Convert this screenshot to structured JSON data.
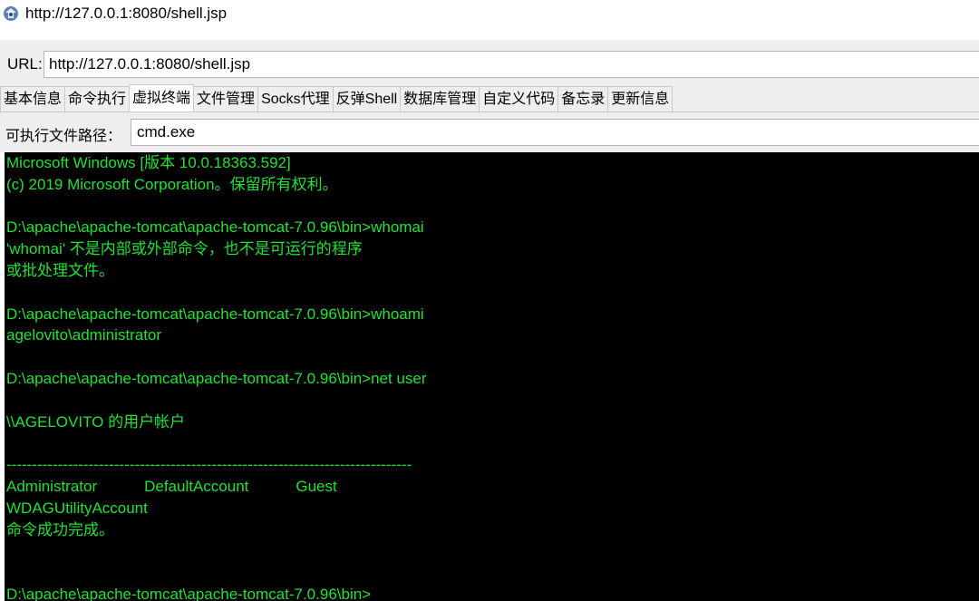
{
  "window": {
    "title": "http://127.0.0.1:8080/shell.jsp"
  },
  "url_bar": {
    "label": "URL:",
    "value": "http://127.0.0.1:8080/shell.jsp"
  },
  "tabs": [
    {
      "label": "基本信息",
      "active": false
    },
    {
      "label": "命令执行",
      "active": false
    },
    {
      "label": "虚拟终端",
      "active": true
    },
    {
      "label": "文件管理",
      "active": false
    },
    {
      "label": "Socks代理",
      "active": false
    },
    {
      "label": "反弹Shell",
      "active": false
    },
    {
      "label": "数据库管理",
      "active": false
    },
    {
      "label": "自定义代码",
      "active": false
    },
    {
      "label": "备忘录",
      "active": false
    },
    {
      "label": "更新信息",
      "active": false
    }
  ],
  "executable": {
    "label": "可执行文件路径：",
    "value": "cmd.exe"
  },
  "terminal": {
    "text_color": "#22e036",
    "background": "#000000",
    "lines": [
      "Microsoft Windows [版本 10.0.18363.592]",
      "(c) 2019 Microsoft Corporation。保留所有权利。",
      "",
      "D:\\apache\\apache-tomcat\\apache-tomcat-7.0.96\\bin>whomai",
      "'whomai' 不是内部或外部命令，也不是可运行的程序",
      "或批处理文件。",
      "",
      "D:\\apache\\apache-tomcat\\apache-tomcat-7.0.96\\bin>whoami",
      "agelovito\\administrator",
      "",
      "D:\\apache\\apache-tomcat\\apache-tomcat-7.0.96\\bin>net user",
      "",
      "\\\\AGELOVITO 的用户帐户",
      "",
      "-------------------------------------------------------------------------------",
      "Administrator           DefaultAccount           Guest",
      "WDAGUtilityAccount",
      "命令成功完成。",
      "",
      "",
      "D:\\apache\\apache-tomcat\\apache-tomcat-7.0.96\\bin>"
    ]
  }
}
